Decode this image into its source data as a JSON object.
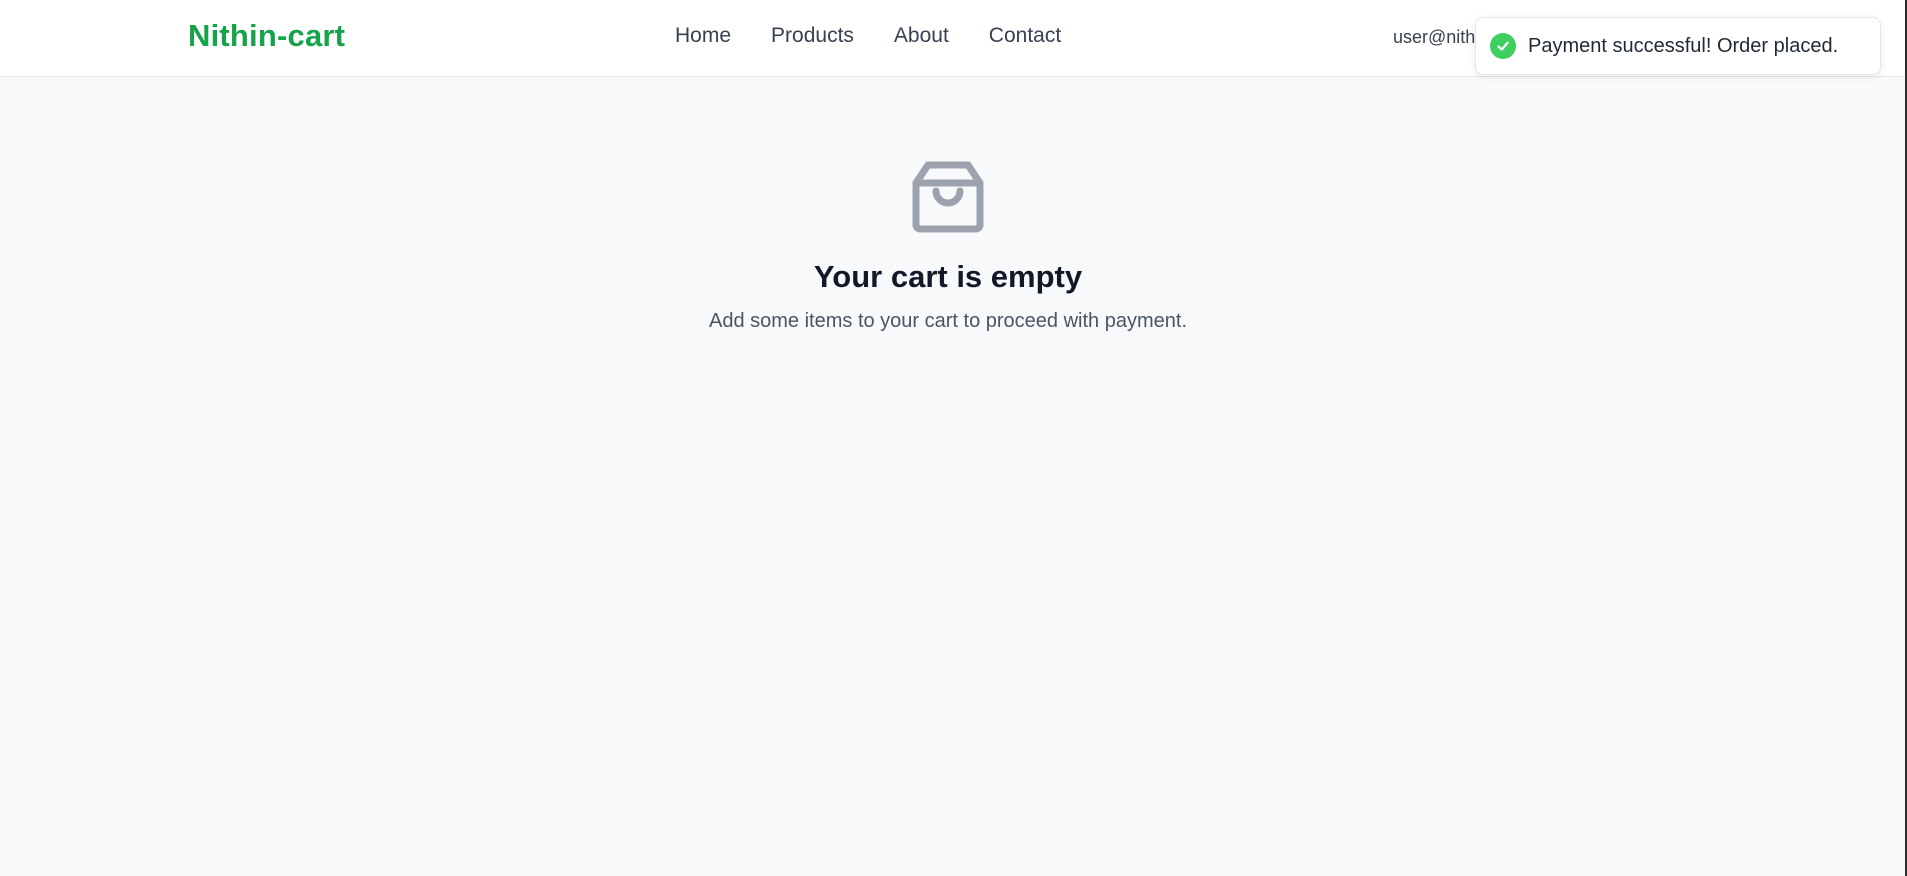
{
  "brand": {
    "name": "Nithin-cart",
    "color": "#16a34a"
  },
  "nav": {
    "links": [
      {
        "label": "Home"
      },
      {
        "label": "Products"
      },
      {
        "label": "About"
      },
      {
        "label": "Contact"
      }
    ]
  },
  "user": {
    "email_visible": "user@nith"
  },
  "cart": {
    "icon": "shopping-bag-icon",
    "title": "Your cart is empty",
    "subtitle": "Add some items to your cart to proceed with payment."
  },
  "toast": {
    "icon": "check-circle-icon",
    "message": "Payment successful! Order placed.",
    "status_color": "#3fcf5f"
  }
}
